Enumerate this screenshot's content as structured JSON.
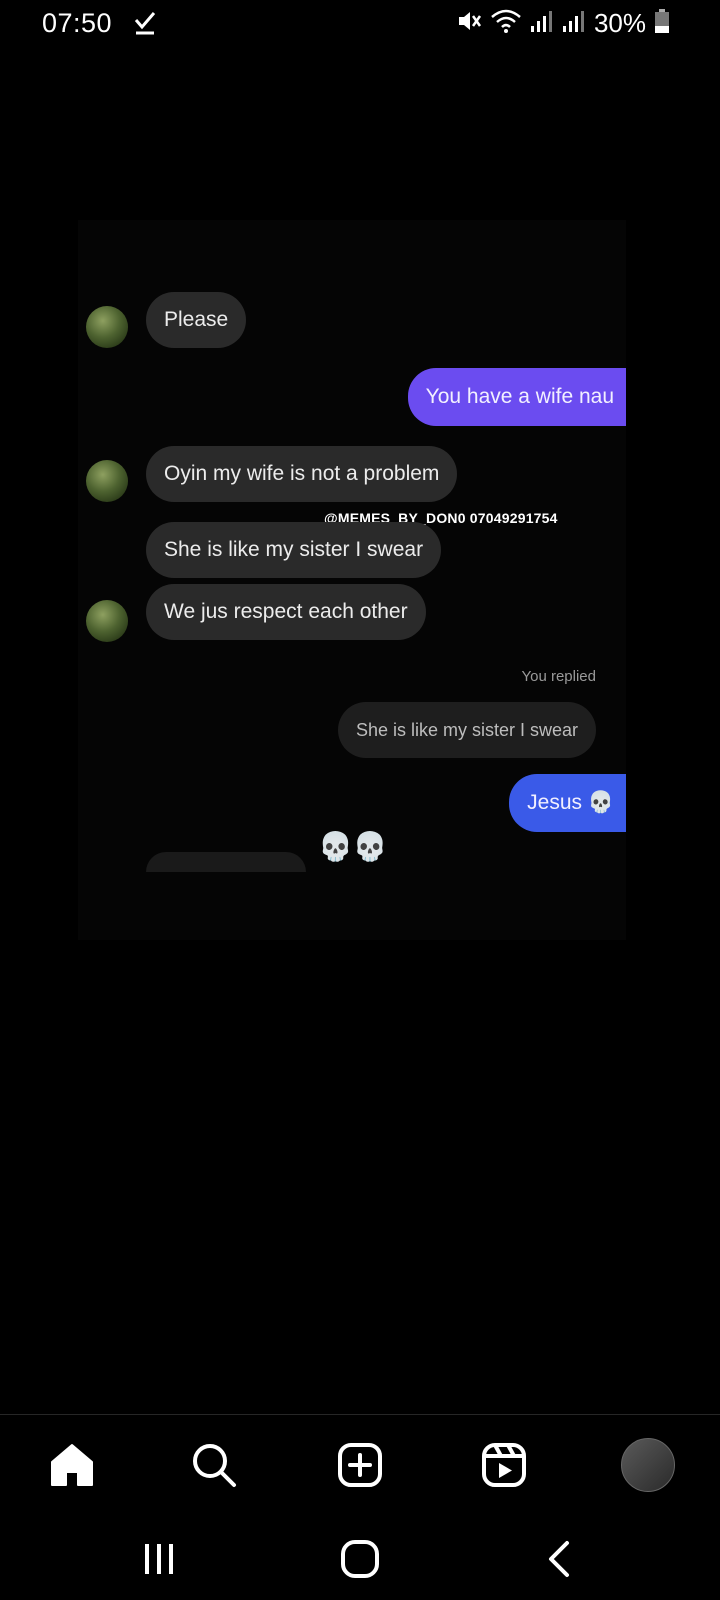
{
  "status_bar": {
    "time": "07:50",
    "battery": "30%",
    "icons": [
      "check-icon",
      "mute-icon",
      "wifi-icon",
      "signal-icon",
      "signal-icon",
      "battery-icon"
    ]
  },
  "post": {
    "watermark": "@MEMES_BY_DON0 07049291754",
    "messages": [
      {
        "id": "m1",
        "side": "in",
        "text": "Please"
      },
      {
        "id": "m2",
        "side": "out",
        "text": "You have a wife nau"
      },
      {
        "id": "m3",
        "side": "in",
        "text": "Oyin my wife is not a problem"
      },
      {
        "id": "m4",
        "side": "in",
        "text": "She is like my sister I swear"
      },
      {
        "id": "m5",
        "side": "in",
        "text": "We jus respect each other"
      },
      {
        "id": "m6",
        "side": "reply",
        "label": "You replied",
        "text": "She is like my sister I swear"
      },
      {
        "id": "m7",
        "side": "out",
        "text": "Jesus 💀"
      },
      {
        "id": "m8",
        "side": "reaction",
        "text": "💀💀"
      }
    ]
  },
  "bottom_nav": {
    "items": [
      "home-icon",
      "search-icon",
      "create-icon",
      "reels-icon",
      "profile-avatar"
    ]
  },
  "system_nav": {
    "items": [
      "recent-apps-icon",
      "home-button-icon",
      "back-icon"
    ]
  },
  "colors": {
    "outgoing_bubble": "#6b4cf0",
    "incoming_bubble": "#2a2a2a",
    "background": "#000000"
  }
}
